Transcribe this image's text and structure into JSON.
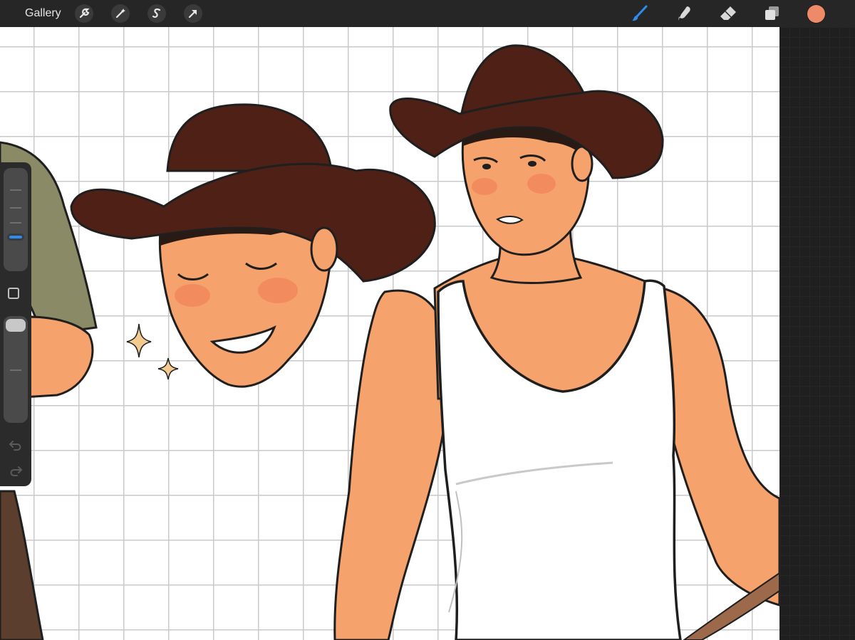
{
  "topbar": {
    "gallery_label": "Gallery",
    "left_tools": [
      {
        "name": "actions",
        "icon": "wrench-icon"
      },
      {
        "name": "adjustments",
        "icon": "magic-wand-icon"
      },
      {
        "name": "selection",
        "icon": "selection-s-icon"
      },
      {
        "name": "transform",
        "icon": "arrow-cursor-icon"
      }
    ],
    "right_tools": [
      {
        "name": "brush",
        "icon": "brush-icon",
        "active": true
      },
      {
        "name": "smudge",
        "icon": "smudge-finger-icon",
        "active": false
      },
      {
        "name": "eraser",
        "icon": "eraser-icon",
        "active": false
      },
      {
        "name": "layers",
        "icon": "layers-icon",
        "active": false
      }
    ],
    "current_color": "#ef8a68",
    "active_tool_color": "#2d8cf0"
  },
  "sidebar": {
    "brush_size_level": 0.6,
    "opacity_level": 0.95,
    "modify_button_icon": "square-icon",
    "undo_icon": "undo-icon",
    "redo_icon": "redo-icon"
  },
  "canvas": {
    "grid": true,
    "background": "#ffffff",
    "hat_color": "#4e2016",
    "skin_color": "#f6a26c",
    "shirt_color": "#ffffff",
    "sparkle_color": "#f2c98e"
  }
}
